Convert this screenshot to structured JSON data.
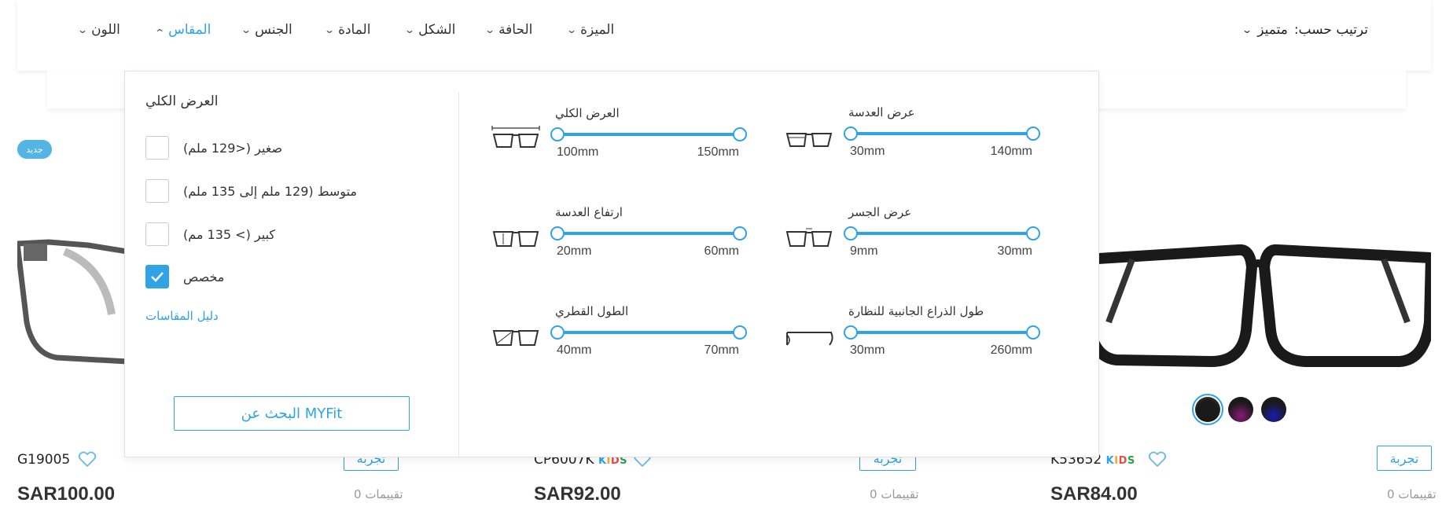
{
  "filters": {
    "color": "اللون",
    "size": "المقاس",
    "gender": "الجنس",
    "material": "المادة",
    "shape": "الشكل",
    "rim": "الحافة",
    "feature": "الميزة",
    "sort_label": "ترتيب حسب:",
    "sort_value": "متميز"
  },
  "badge_new": "جديد",
  "panel": {
    "left_title": "العرض الكلي",
    "options": [
      {
        "label": "صغير (<129 ملم)",
        "checked": false
      },
      {
        "label": "متوسط (129 ملم إلى 135 ملم)",
        "checked": false
      },
      {
        "label": "كبير (> 135 مم)",
        "checked": false
      },
      {
        "label": "مخصص",
        "checked": true
      }
    ],
    "guide_link": "دليل المقاسات",
    "myfit_button": "البحث عن MYFit",
    "sliders": [
      {
        "label": "العرض الكلي",
        "min": "100mm",
        "max": "150mm",
        "icon": "total-width-icon"
      },
      {
        "label": "عرض العدسة",
        "min": "30mm",
        "max": "140mm",
        "icon": "lens-width-icon"
      },
      {
        "label": "ارتفاع العدسة",
        "min": "20mm",
        "max": "60mm",
        "icon": "lens-height-icon"
      },
      {
        "label": "عرض الجسر",
        "min": "9mm",
        "max": "30mm",
        "icon": "bridge-width-icon"
      },
      {
        "label": "الطول القطري",
        "min": "40mm",
        "max": "70mm",
        "icon": "diagonal-icon"
      },
      {
        "label": "طول الذراع الجانبية للنظارة",
        "min": "30mm",
        "max": "260mm",
        "icon": "temple-length-icon"
      }
    ]
  },
  "products": [
    {
      "name": "G19005",
      "kids": false,
      "price": "SAR100.00",
      "ratings": "تقييمات 0",
      "try_label": "تجربة"
    },
    {
      "name": "CP6007K",
      "kids": true,
      "price": "SAR92.00",
      "ratings": "تقييمات 0",
      "try_label": "تجربة"
    },
    {
      "name": "K53652",
      "kids": true,
      "price": "SAR84.00",
      "ratings": "تقييمات 0",
      "try_label": "تجربة"
    }
  ],
  "kids_label": {
    "k": "K",
    "i": "I",
    "d": "D",
    "s": "S"
  },
  "colors": {
    "accent": "#2ea3e6",
    "swatch_1": "#1a1a1a",
    "swatch_2_tint": "#8b1a7a",
    "swatch_3_tint": "#1a1ab0"
  }
}
